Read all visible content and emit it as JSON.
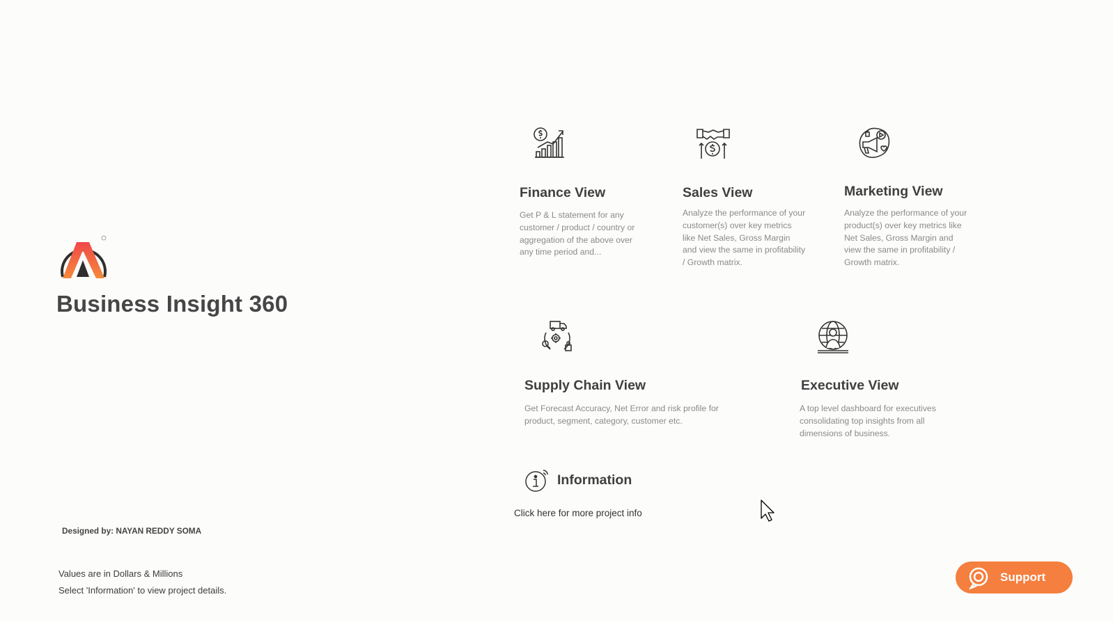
{
  "brand": {
    "title": "Business Insight 360",
    "logo_icon": "brand-logo",
    "colors": {
      "gradient_top": "#f0474a",
      "gradient_bottom": "#f58a3a",
      "arch": "#2f2f2f"
    }
  },
  "views": [
    {
      "icon": "finance-chart-icon",
      "title": "Finance View",
      "description": "Get P & L statement for any customer / product / country or aggregation of the above over any time period and..."
    },
    {
      "icon": "handshake-coin-icon",
      "title": "Sales View",
      "description": "Analyze the performance of your customer(s) over key metrics like Net Sales, Gross Margin and view the same in profitability / Growth matrix."
    },
    {
      "icon": "marketing-megaphone-icon",
      "title": "Marketing View",
      "description": "Analyze the performance of your product(s) over key metrics like Net Sales, Gross Margin and view the same in profitability / Growth matrix."
    },
    {
      "icon": "supply-chain-icon",
      "title": "Supply Chain View",
      "description": "Get Forecast Accuracy, Net Error and risk profile for product, segment, category, customer etc."
    },
    {
      "icon": "executive-globe-icon",
      "title": "Executive View",
      "description": "A top level dashboard for executives consolidating top insights from all dimensions of business."
    }
  ],
  "information": {
    "icon": "info-icon",
    "title": "Information",
    "link_text": "Click here for more project info"
  },
  "footer": {
    "designed_by": "Designed by: NAYAN REDDY SOMA",
    "note_values": "Values are in Dollars & Millions",
    "note_select": "Select 'Information' to view project details."
  },
  "support": {
    "label": "Support",
    "icon": "support-chat-icon",
    "color": "#f47f3e"
  }
}
